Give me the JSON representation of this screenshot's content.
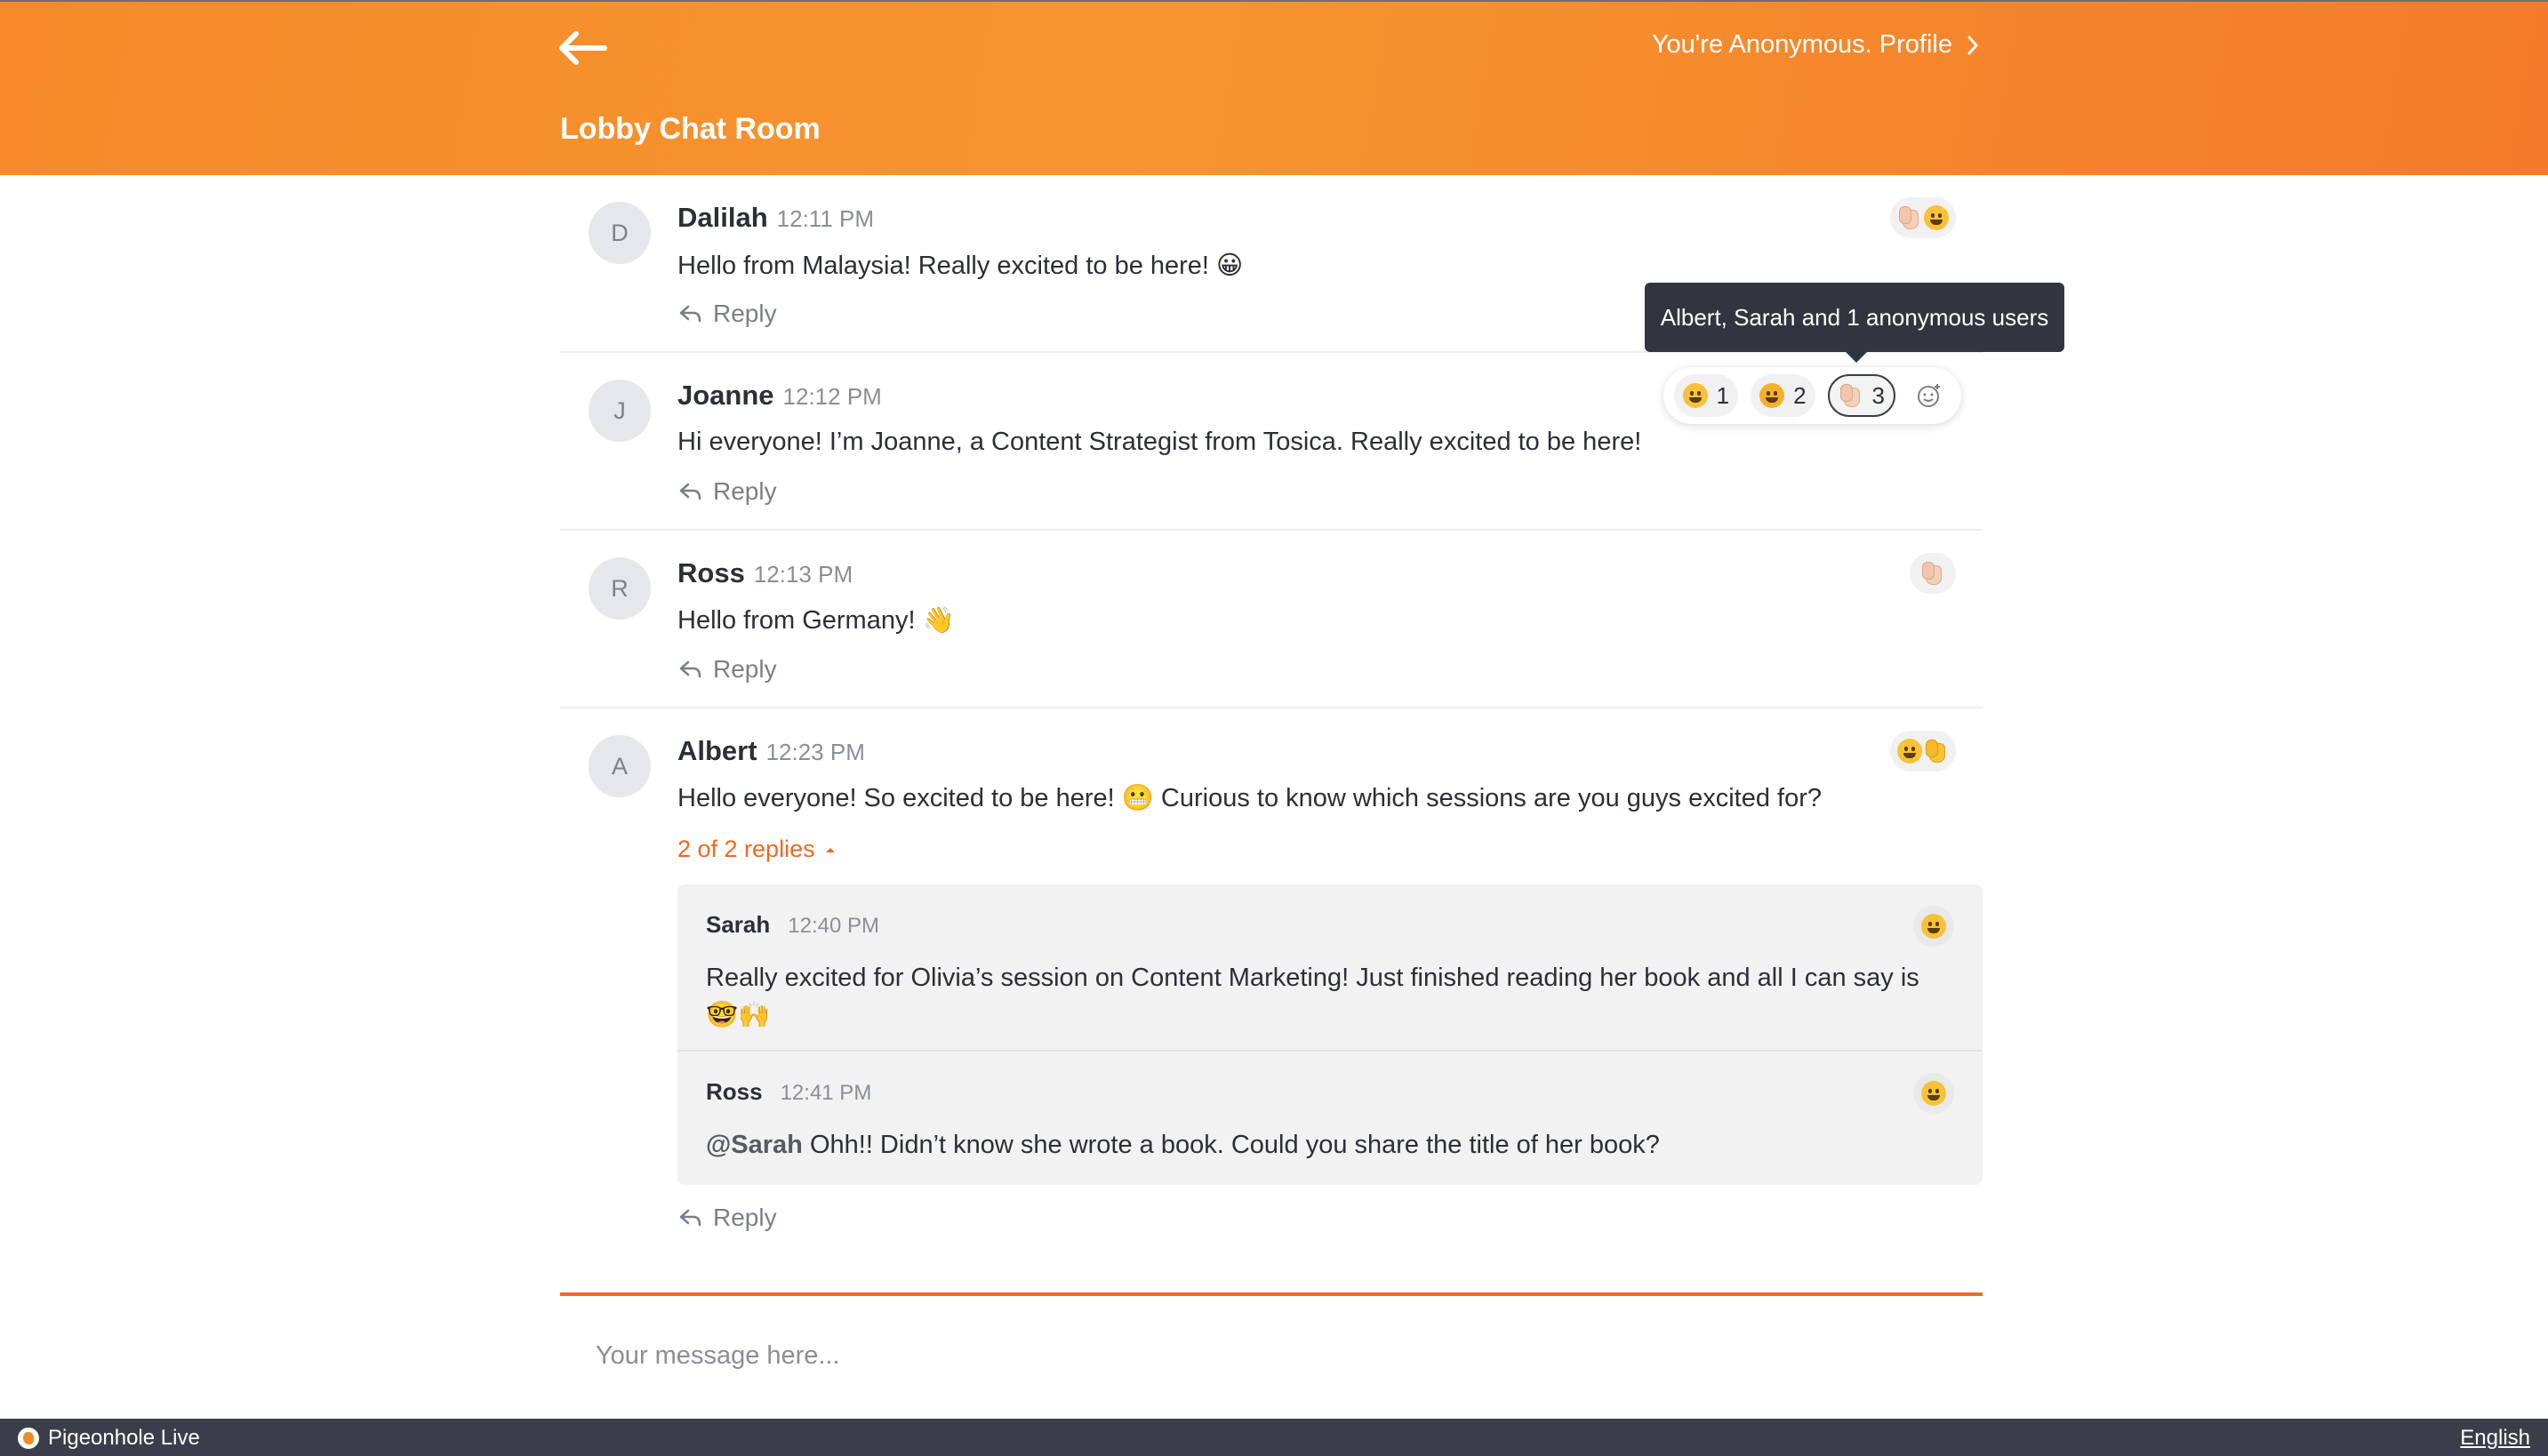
{
  "header": {
    "profile_text": "You're Anonymous. Profile",
    "room_title": "Lobby Chat Room"
  },
  "messages": [
    {
      "initial": "D",
      "author": "Dalilah",
      "time": "12:11 PM",
      "text": "Hello from Malaysia! Really excited to be here! 😀",
      "reply": "Reply"
    },
    {
      "initial": "J",
      "author": "Joanne",
      "time": "12:12 PM",
      "text": "Hi everyone! I’m Joanne, a Content Strategist from Tosica. Really excited to be here!",
      "reply": "Reply",
      "reactions": [
        {
          "icon": "grin-emoji",
          "count": "1"
        },
        {
          "icon": "hug-emoji",
          "count": "2"
        },
        {
          "icon": "wave-hand-emoji",
          "count": "3"
        }
      ]
    },
    {
      "initial": "R",
      "author": "Ross",
      "time": "12:13 PM",
      "text": "Hello from Germany! 👋",
      "reply": "Reply"
    },
    {
      "initial": "A",
      "author": "Albert",
      "time": "12:23 PM",
      "text": "Hello everyone! So excited to be here! 😬 Curious to know which sessions are you guys excited for?",
      "reply": "Reply",
      "thread_toggle": "2 of 2 replies"
    }
  ],
  "tooltip": "Albert, Sarah and 1 anonymous users",
  "thread": [
    {
      "author": "Sarah",
      "time": "12:40 PM",
      "text": "Really excited for Olivia’s session on Content Marketing! Just finished reading her book and all I can say is 🤓🙌"
    },
    {
      "author": "Ross",
      "time": "12:41 PM",
      "mention": "@Sarah",
      "text": " Ohh!! Didn’t know she wrote a book. Could you share the title of her book?"
    }
  ],
  "composer": {
    "placeholder": "Your message here..."
  },
  "footer": {
    "brand": "Pigeonhole Live",
    "language": "English"
  },
  "colors": {
    "accent": "#f68a2a",
    "link": "#ec6a1f",
    "footer": "#3a3e4a",
    "tooltip": "#323540"
  }
}
